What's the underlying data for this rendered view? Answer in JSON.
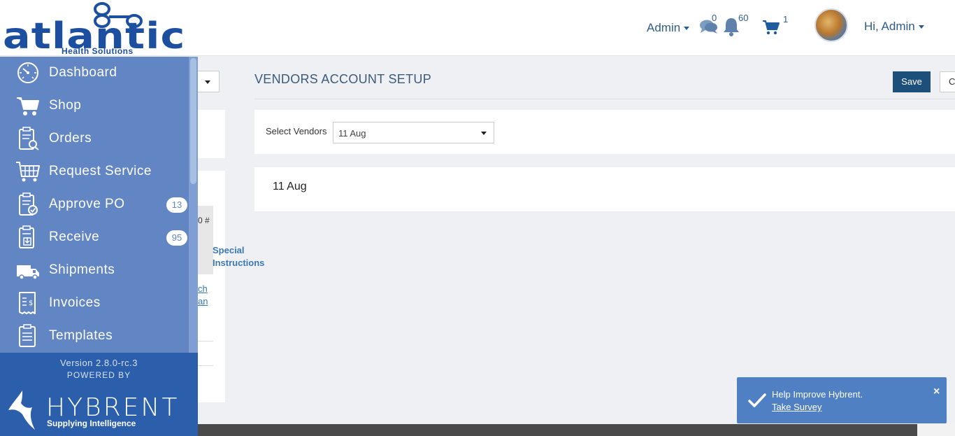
{
  "brand": {
    "logo_word": "atlantic",
    "logo_tagline": "Health Solutions"
  },
  "header": {
    "admin_menu": "Admin",
    "messages_count": "0",
    "notifications_count": "60",
    "cart_count": "1",
    "greeting": "Hi, Admin"
  },
  "sidebar": {
    "items": [
      {
        "label": "Dashboard",
        "icon": "dashboard-icon"
      },
      {
        "label": "Shop",
        "icon": "cart-icon"
      },
      {
        "label": "Orders",
        "icon": "orders-clipboard-icon"
      },
      {
        "label": "Request Service",
        "icon": "request-service-icon"
      },
      {
        "label": "Approve PO",
        "icon": "approve-clipboard-icon",
        "badge": "13"
      },
      {
        "label": "Receive",
        "icon": "receive-clipboard-icon",
        "badge": "95"
      },
      {
        "label": "Shipments",
        "icon": "truck-icon"
      },
      {
        "label": "Invoices",
        "icon": "invoice-icon"
      },
      {
        "label": "Templates",
        "icon": "template-clipboard-icon"
      }
    ],
    "version": "Version 2.8.0-rc.3",
    "powered_by": "POWERED BY",
    "hybrent_word": "HYBRENT",
    "hybrent_tagline": "Supplying Intelligence"
  },
  "background_panel": {
    "po_header_fragment": "0 #",
    "link_fragment_1": "ch",
    "link_fragment_2": "an",
    "special_instructions_1": "Special",
    "special_instructions_2": "Instructions"
  },
  "main": {
    "title": "VENDORS ACCOUNT SETUP",
    "save_label": "Save",
    "cancel_label": "C",
    "select_vendors_label": "Select Vendors",
    "selected_vendor": "11 Aug",
    "vendor_name": "11 Aug"
  },
  "toast": {
    "message": "Help Improve Hybrent.",
    "link": "Take Survey",
    "close": "×"
  },
  "colors": {
    "sidebar": "#6186c3",
    "sidebar_footer": "#2c5fab",
    "primary_button": "#1d4f7b",
    "toast": "#4f80c3",
    "header_text": "#2f5d8a"
  }
}
